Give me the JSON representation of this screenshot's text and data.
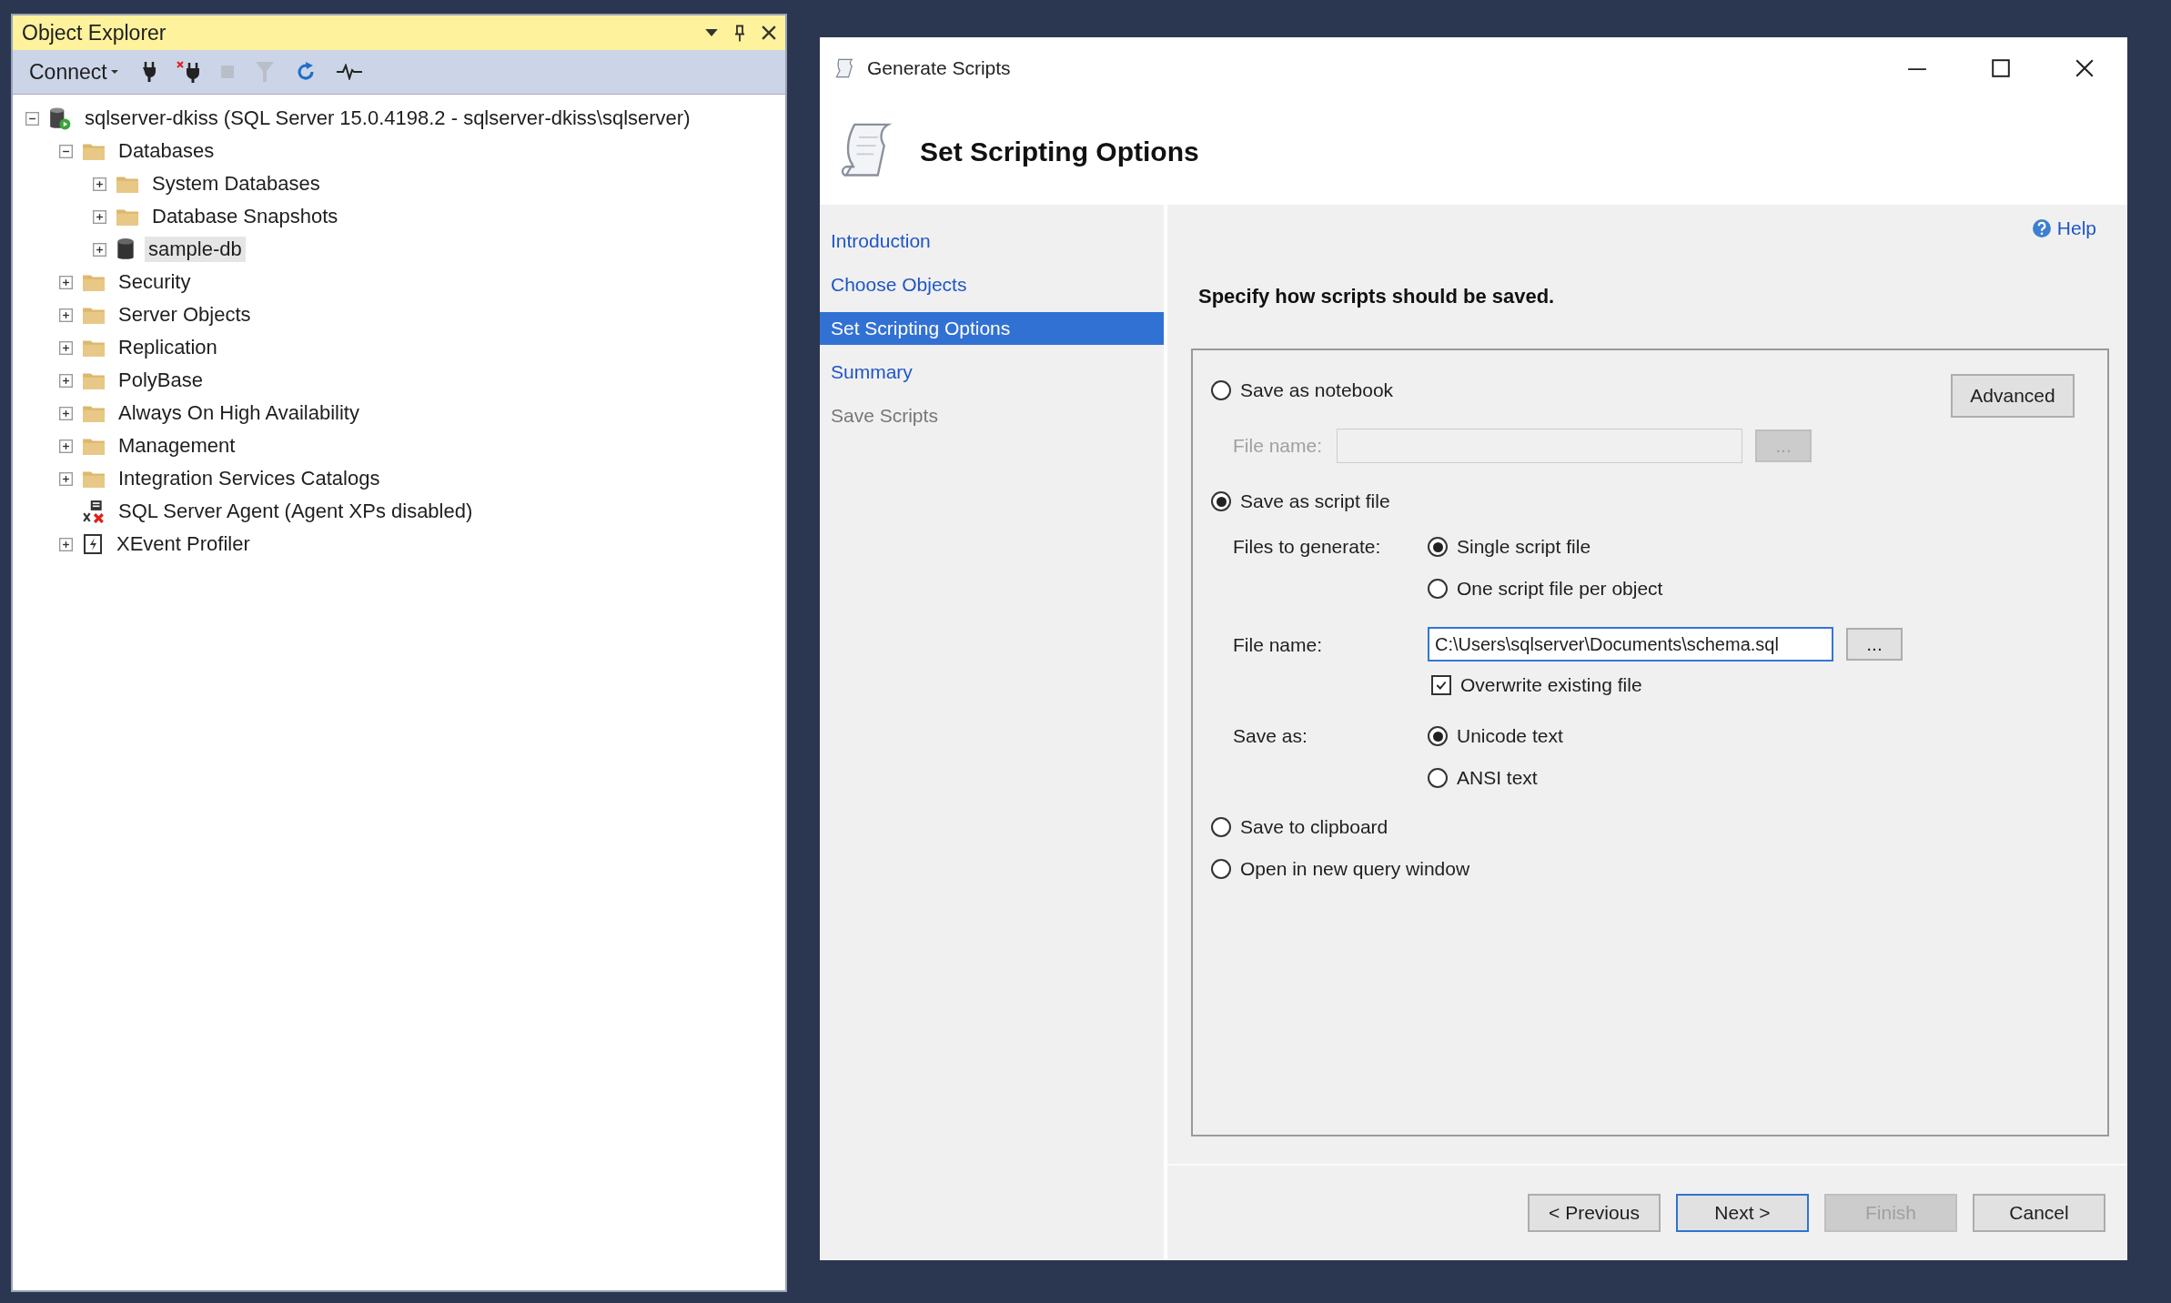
{
  "object_explorer": {
    "title": "Object Explorer",
    "connect": "Connect",
    "tree": [
      {
        "label": "sqlserver-dkiss (SQL Server 15.0.4198.2 - sqlserver-dkiss\\sqlserver)",
        "kind": "server",
        "expanded": true,
        "selected": false,
        "children": [
          {
            "label": "Databases",
            "kind": "folder",
            "expanded": true,
            "selected": false,
            "children": [
              {
                "label": "System Databases",
                "kind": "folder",
                "expanded": false,
                "selected": false
              },
              {
                "label": "Database Snapshots",
                "kind": "folder",
                "expanded": false,
                "selected": false
              },
              {
                "label": "sample-db",
                "kind": "database",
                "expanded": false,
                "selected": true
              }
            ]
          },
          {
            "label": "Security",
            "kind": "folder",
            "expanded": false,
            "selected": false
          },
          {
            "label": "Server Objects",
            "kind": "folder",
            "expanded": false,
            "selected": false
          },
          {
            "label": "Replication",
            "kind": "folder",
            "expanded": false,
            "selected": false
          },
          {
            "label": "PolyBase",
            "kind": "folder",
            "expanded": false,
            "selected": false
          },
          {
            "label": "Always On High Availability",
            "kind": "folder",
            "expanded": false,
            "selected": false
          },
          {
            "label": "Management",
            "kind": "folder",
            "expanded": false,
            "selected": false
          },
          {
            "label": "Integration Services Catalogs",
            "kind": "folder",
            "expanded": false,
            "selected": false
          },
          {
            "label": "SQL Server Agent (Agent XPs disabled)",
            "kind": "agent",
            "selected": false
          },
          {
            "label": "XEvent Profiler",
            "kind": "profiler",
            "expanded": false,
            "selected": false
          }
        ]
      }
    ]
  },
  "dialog": {
    "title": "Generate Scripts",
    "heading": "Set Scripting Options",
    "nav": [
      {
        "label": "Introduction",
        "selected": false,
        "disabled": false
      },
      {
        "label": "Choose Objects",
        "selected": false,
        "disabled": false
      },
      {
        "label": "Set Scripting Options",
        "selected": true,
        "disabled": false
      },
      {
        "label": "Summary",
        "selected": false,
        "disabled": false
      },
      {
        "label": "Save Scripts",
        "selected": false,
        "disabled": true
      }
    ],
    "help": "Help",
    "instruction": "Specify how scripts should be saved.",
    "advanced": "Advanced",
    "notebook": {
      "label": "Save as notebook",
      "selected": false,
      "file_name_label": "File name:",
      "browse": "...",
      "disabled": true
    },
    "script_file": {
      "label": "Save as script file",
      "selected": true,
      "files_label": "Files to generate:",
      "files_options": [
        {
          "label": "Single script file",
          "selected": true
        },
        {
          "label": "One script file per object",
          "selected": false
        }
      ],
      "file_name_label": "File name:",
      "file_name": "C:\\Users\\sqlserver\\Documents\\schema.sql",
      "browse": "...",
      "overwrite": {
        "label": "Overwrite existing file",
        "checked": true
      },
      "save_as_label": "Save as:",
      "save_as_options": [
        {
          "label": "Unicode text",
          "selected": true
        },
        {
          "label": "ANSI text",
          "selected": false
        }
      ]
    },
    "other_modes": [
      {
        "label": "Save to clipboard",
        "selected": false
      },
      {
        "label": "Open in new query window",
        "selected": false
      }
    ],
    "buttons": [
      {
        "label": "< Previous",
        "disabled": false,
        "default": false
      },
      {
        "label": "Next >",
        "disabled": false,
        "default": true
      },
      {
        "label": "Finish",
        "disabled": true,
        "default": false
      },
      {
        "label": "Cancel",
        "disabled": false,
        "default": false
      }
    ]
  }
}
